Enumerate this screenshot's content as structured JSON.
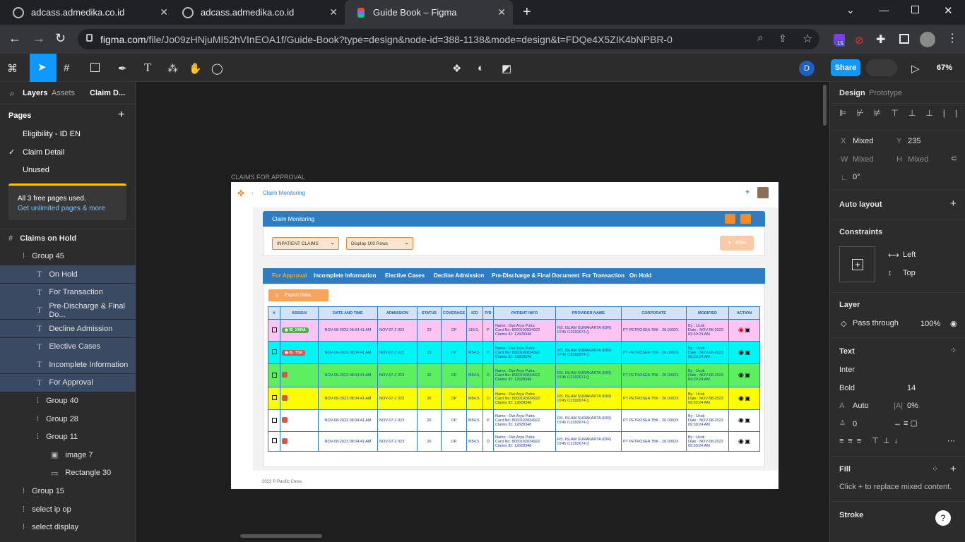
{
  "browser": {
    "tabs": [
      {
        "title": "adcass.admedika.co.id"
      },
      {
        "title": "adcass.admedika.co.id"
      },
      {
        "title": "Guide Book – Figma"
      }
    ],
    "url_domain": "figma.com",
    "url_path": "/file/Jo09zHNjuMI52hVInEOA1f/Guide-Book?type=design&node-id=388-1138&mode=design&t=FDQe4X5ZIK4bNPBR-0",
    "ext_badge": "15"
  },
  "figma": {
    "share_label": "Share",
    "zoom": "67%",
    "avatar": "D",
    "left": {
      "tabs": [
        "Layers",
        "Assets",
        "Claim D..."
      ],
      "pages_title": "Pages",
      "pages": [
        "Eligibility - ID EN",
        "Claim Detail",
        "Unused"
      ],
      "notice": "All 3 free pages used.",
      "notice_link": "Get unlimited pages & more",
      "layers": [
        {
          "label": "Claims on Hold",
          "type": "frame",
          "indent": 12,
          "sel": false
        },
        {
          "label": "Group 45",
          "type": "group",
          "indent": 32,
          "sel": false
        },
        {
          "label": "On Hold",
          "type": "text",
          "indent": 52,
          "sel": true
        },
        {
          "label": "For Transaction",
          "type": "text",
          "indent": 52,
          "sel": true
        },
        {
          "label": "Pre-Discharge & Final Do...",
          "type": "text",
          "indent": 52,
          "sel": true
        },
        {
          "label": "Decline Admission",
          "type": "text",
          "indent": 52,
          "sel": true
        },
        {
          "label": "Elective Cases",
          "type": "text",
          "indent": 52,
          "sel": true
        },
        {
          "label": "Incomplete Information",
          "type": "text",
          "indent": 52,
          "sel": true
        },
        {
          "label": "For Approval",
          "type": "text",
          "indent": 52,
          "sel": true
        },
        {
          "label": "Group 40",
          "type": "group",
          "indent": 52,
          "sel": false
        },
        {
          "label": "Group 28",
          "type": "group",
          "indent": 52,
          "sel": false
        },
        {
          "label": "Group 11",
          "type": "group",
          "indent": 52,
          "sel": false
        },
        {
          "label": "image 7",
          "type": "image",
          "indent": 72,
          "sel": false
        },
        {
          "label": "Rectangle 30",
          "type": "rect",
          "indent": 72,
          "sel": false
        },
        {
          "label": "Group 15",
          "type": "group",
          "indent": 32,
          "sel": false
        },
        {
          "label": "select ip op",
          "type": "group",
          "indent": 32,
          "sel": false
        },
        {
          "label": "select display",
          "type": "group",
          "indent": 32,
          "sel": false
        }
      ]
    },
    "right": {
      "tabs": [
        "Design",
        "Prototype"
      ],
      "x_label": "X",
      "x_value": "Mixed",
      "y_label": "Y",
      "y_value": "235",
      "w_label": "W",
      "w_value": "Mixed",
      "h_label": "H",
      "h_value": "Mixed",
      "rotation": "0°",
      "auto_layout": "Auto layout",
      "constraints": "Constraints",
      "c_left": "Left",
      "c_top": "Top",
      "layer": "Layer",
      "blend": "Pass through",
      "opacity": "100%",
      "text": "Text",
      "font": "Inter",
      "weight": "Bold",
      "size": "14",
      "line_height": "Auto",
      "letter_spacing": "0%",
      "para": "0",
      "fill": "Fill",
      "fill_note": "Click + to replace mixed content.",
      "stroke": "Stroke"
    },
    "frame_label": "CLAIMS FOR APPROVAL"
  },
  "mock": {
    "breadcrumb": "Claim Monitoring",
    "panel_title": "Claim Monitoring",
    "select1": "INPATIENT CLAIMS",
    "select2": "Display 100 Rows",
    "filter": "Filter",
    "tabs": [
      "For Approval",
      "Incomplete Information",
      "Elective Cases",
      "Decline Admission",
      "Pre-Discharge & Final Document",
      "For Transaction",
      "On Hold"
    ],
    "export": "Export Data",
    "footer": "2023 © Pacific Cross",
    "headers": [
      "#",
      "ASSIGN",
      "DATE AND TIME",
      "ADMISSION",
      "STATUS",
      "COVERAGE",
      "ICD",
      "P/D",
      "PATIENT INFO",
      "PROVIDER NAME",
      "CORPORATE",
      "MODIFIED",
      "ACTION"
    ],
    "rows": [
      {
        "bg": "#fbc4f3",
        "assign": "IS_XXNA",
        "assign_color": "#4caf50",
        "date": "NOV-08-2023 08:04:41 AM",
        "adm": "NOV-07-2 023",
        "status": "23",
        "cov": "OP",
        "icd": "J18.0,",
        "pd": "P"
      },
      {
        "bg": "#00f5f5",
        "assign": "IS_TSX",
        "assign_color": "#d9534f",
        "date": "NOV-08-2023 08:04:41 AM",
        "adm": "NOV-07-2 023",
        "status": "23",
        "cov": "OP",
        "icd": "M54.5,",
        "pd": "P"
      },
      {
        "bg": "#5cf060",
        "assign": "",
        "assign_color": "#d9534f",
        "date": "NOV-08-2023 08:04:41 AM",
        "adm": "NOV-07-2 023",
        "status": "26",
        "cov": "OP",
        "icd": "M54.5,",
        "pd": "D"
      },
      {
        "bg": "#fdfd00",
        "assign": "",
        "assign_color": "#d9534f",
        "date": "NOV-08-2023 08:04:41 AM",
        "adm": "NOV-07-2 023",
        "status": "26",
        "cov": "OP",
        "icd": "M54.5,",
        "pd": "D"
      },
      {
        "bg": "#ffffff",
        "assign": "",
        "assign_color": "#d9534f",
        "date": "NOV-08-2023 08:04:41 AM",
        "adm": "NOV-07-2 023",
        "status": "26",
        "cov": "OP",
        "icd": "M54.5,",
        "pd": "P"
      },
      {
        "bg": "#ffffff",
        "assign": "",
        "assign_color": "#d9534f",
        "date": "NOV-08-2023 08:04:41 AM",
        "adm": "NOV-07-2 023",
        "status": "26",
        "cov": "OP",
        "icd": "M54.5,",
        "pd": "D"
      }
    ],
    "patient": [
      "Name : Dwi Arya Putra",
      "Card No: 8000192834922",
      "Claims ID: 12828348"
    ],
    "provider": [
      "RS. ISLAM SURAKARTA (IDR)",
      "0745 /12392674 ()"
    ],
    "corporate": "PT PETROSEA TBK - 20.0002X",
    "modified": [
      "By : Ucok",
      "Date : NOV-08-2023",
      "09:30:24 AM"
    ]
  }
}
